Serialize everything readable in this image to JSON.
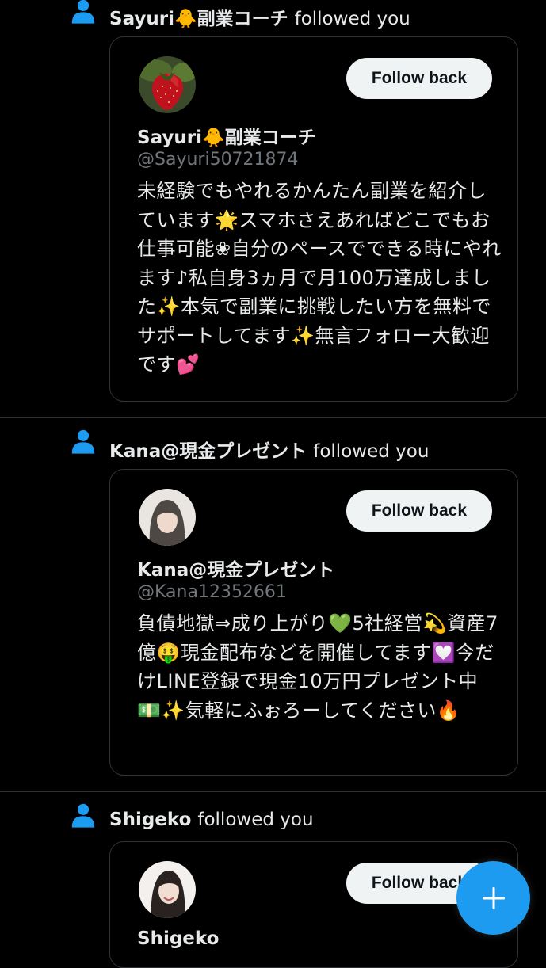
{
  "notifications": [
    {
      "head_name": "Sayuri🐥副業コーチ",
      "head_suffix": "followed you",
      "card_name": "Sayuri🐥副業コーチ",
      "handle": "@Sayuri50721874",
      "bio": "未経験でもやれるかんたん副業を紹介しています🌟スマホさえあればどこでもお仕事可能❀自分のペースでできる時にやれます♪私自身3ヵ月で月100万達成しました✨本気で副業に挑戦したい方を無料でサポートしてます✨無言フォロー大歓迎です💕",
      "button": "Follow back",
      "avatar": "strawberry"
    },
    {
      "head_name": "Kana@現金プレゼント",
      "head_suffix": "followed you",
      "card_name": "Kana@現金プレゼント",
      "handle": "@Kana12352661",
      "bio": "負債地獄⇒成り上がり💚5社経営💫資産7億🤑現金配布などを開催してます💟今だけLINE登録で現金10万円プレゼント中💵✨気軽にふぉろーしてください🔥",
      "button": "Follow back",
      "avatar": "woman-hair"
    },
    {
      "head_name": "Shigeko",
      "head_suffix": "followed you",
      "card_name": "Shigeko",
      "handle": "",
      "bio": "",
      "button": "Follow back",
      "avatar": "woman-smile"
    }
  ],
  "fab": {
    "icon": "plus-icon"
  },
  "colors": {
    "background": "#000000",
    "accent": "#1d9bf0",
    "text": "#e7e9ea",
    "muted": "#71767b",
    "border": "#2f3336",
    "button_bg": "#eff3f4"
  }
}
